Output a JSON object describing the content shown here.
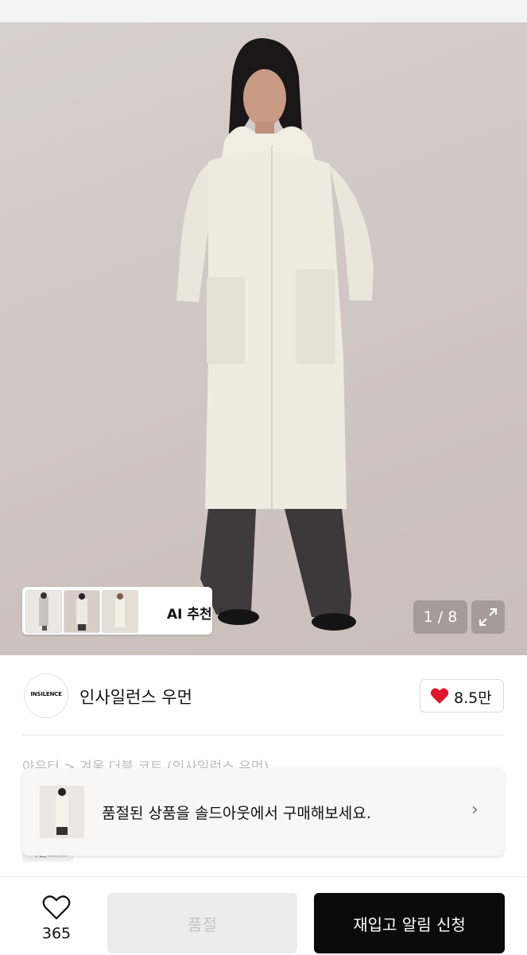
{
  "gallery": {
    "counter": "1 / 8",
    "ai_recommend_label": "AI 추천",
    "expand_icon": "expand-icon"
  },
  "brand": {
    "logo_text": "INSILENCE",
    "name": "인사일런스 우먼",
    "like_count": "8.5만",
    "accent": "#e0162b"
  },
  "product": {
    "breadcrumb": "아우터 > 겨울 더블 코트 (인사일런스 우먼)",
    "tag_peek": "시즌오프"
  },
  "soldout_banner": {
    "text": "품절된 상품을 솔드아웃에서 구매해보세요."
  },
  "bottom_bar": {
    "wish_count": "365",
    "soldout_label": "품절",
    "restock_label": "재입고 알림 신청"
  }
}
